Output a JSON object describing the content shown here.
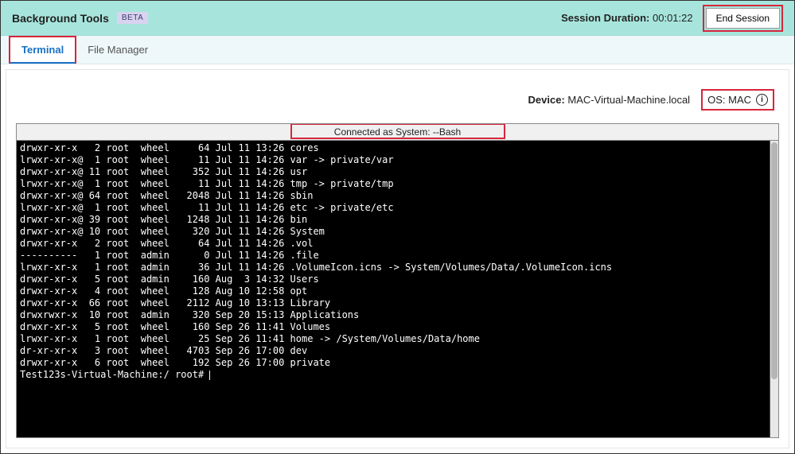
{
  "header": {
    "title": "Background Tools",
    "badge": "BETA",
    "session_label": "Session Duration:",
    "session_time": "00:01:22",
    "end_session_label": "End Session"
  },
  "tabs": [
    {
      "label": "Terminal",
      "active": true
    },
    {
      "label": "File Manager",
      "active": false
    }
  ],
  "device": {
    "label": "Device:",
    "name": "MAC-Virtual-Machine.local",
    "os_label": "OS:",
    "os_value": "MAC"
  },
  "terminal": {
    "status": "Connected as System: --Bash",
    "prompt": "Test123s-Virtual-Machine:/ root# ",
    "rows": [
      {
        "perm": "drwxr-xr-x ",
        "links": " 2",
        "user": "root",
        "group": "wheel",
        "size": "  64",
        "date": "Jul 11 13:26",
        "name": "cores"
      },
      {
        "perm": "lrwxr-xr-x@",
        "links": " 1",
        "user": "root",
        "group": "wheel",
        "size": "  11",
        "date": "Jul 11 14:26",
        "name": "var -> private/var"
      },
      {
        "perm": "drwxr-xr-x@",
        "links": "11",
        "user": "root",
        "group": "wheel",
        "size": " 352",
        "date": "Jul 11 14:26",
        "name": "usr"
      },
      {
        "perm": "lrwxr-xr-x@",
        "links": " 1",
        "user": "root",
        "group": "wheel",
        "size": "  11",
        "date": "Jul 11 14:26",
        "name": "tmp -> private/tmp"
      },
      {
        "perm": "drwxr-xr-x@",
        "links": "64",
        "user": "root",
        "group": "wheel",
        "size": "2048",
        "date": "Jul 11 14:26",
        "name": "sbin"
      },
      {
        "perm": "lrwxr-xr-x@",
        "links": " 1",
        "user": "root",
        "group": "wheel",
        "size": "  11",
        "date": "Jul 11 14:26",
        "name": "etc -> private/etc"
      },
      {
        "perm": "drwxr-xr-x@",
        "links": "39",
        "user": "root",
        "group": "wheel",
        "size": "1248",
        "date": "Jul 11 14:26",
        "name": "bin"
      },
      {
        "perm": "drwxr-xr-x@",
        "links": "10",
        "user": "root",
        "group": "wheel",
        "size": " 320",
        "date": "Jul 11 14:26",
        "name": "System"
      },
      {
        "perm": "drwxr-xr-x ",
        "links": " 2",
        "user": "root",
        "group": "wheel",
        "size": "  64",
        "date": "Jul 11 14:26",
        "name": ".vol"
      },
      {
        "perm": "----------",
        "links": " 1",
        "user": "root",
        "group": "admin",
        "size": "   0",
        "date": "Jul 11 14:26",
        "name": ".file"
      },
      {
        "perm": "lrwxr-xr-x ",
        "links": " 1",
        "user": "root",
        "group": "admin",
        "size": "  36",
        "date": "Jul 11 14:26",
        "name": ".VolumeIcon.icns -> System/Volumes/Data/.VolumeIcon.icns"
      },
      {
        "perm": "drwxr-xr-x ",
        "links": " 5",
        "user": "root",
        "group": "admin",
        "size": " 160",
        "date": "Aug  3 14:32",
        "name": "Users"
      },
      {
        "perm": "drwxr-xr-x ",
        "links": " 4",
        "user": "root",
        "group": "wheel",
        "size": " 128",
        "date": "Aug 10 12:58",
        "name": "opt"
      },
      {
        "perm": "drwxr-xr-x ",
        "links": "66",
        "user": "root",
        "group": "wheel",
        "size": "2112",
        "date": "Aug 10 13:13",
        "name": "Library"
      },
      {
        "perm": "drwxrwxr-x ",
        "links": "10",
        "user": "root",
        "group": "admin",
        "size": " 320",
        "date": "Sep 20 15:13",
        "name": "Applications"
      },
      {
        "perm": "drwxr-xr-x ",
        "links": " 5",
        "user": "root",
        "group": "wheel",
        "size": " 160",
        "date": "Sep 26 11:41",
        "name": "Volumes"
      },
      {
        "perm": "lrwxr-xr-x ",
        "links": " 1",
        "user": "root",
        "group": "wheel",
        "size": "  25",
        "date": "Sep 26 11:41",
        "name": "home -> /System/Volumes/Data/home"
      },
      {
        "perm": "dr-xr-xr-x ",
        "links": " 3",
        "user": "root",
        "group": "wheel",
        "size": "4703",
        "date": "Sep 26 17:00",
        "name": "dev"
      },
      {
        "perm": "drwxr-xr-x ",
        "links": " 6",
        "user": "root",
        "group": "wheel",
        "size": " 192",
        "date": "Sep 26 17:00",
        "name": "private"
      }
    ]
  }
}
